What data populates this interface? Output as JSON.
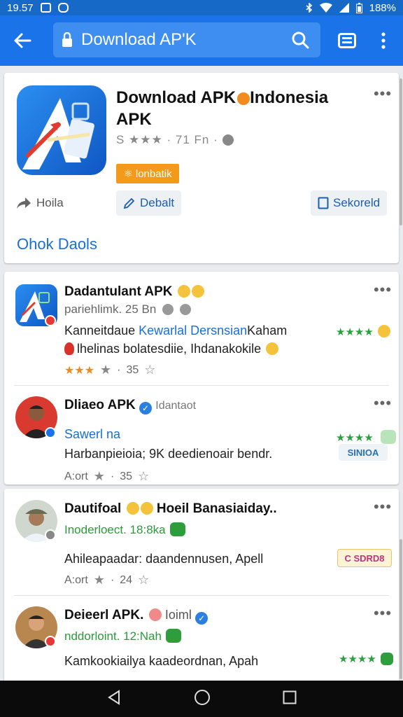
{
  "status_bar": {
    "time": "19.57",
    "battery": "188%"
  },
  "search": {
    "value": "Download AP'K"
  },
  "hero": {
    "title": "Download APK●Indonesia APK",
    "title_line1": "Download APK",
    "title_line1b": "Indonesia",
    "title_line2": "APK",
    "rating_text": "S ★★★ · 71 Fn ·",
    "install_label": "lonbatik",
    "share_label": "Hoila",
    "detail_label": "Debalt",
    "save_label": "Sekoreld",
    "link_label": "Ohok Daols"
  },
  "list_card1": {
    "items": [
      {
        "title": "Dadantulant APK",
        "subtitle": "pariehlimk. 25 Bn",
        "text1_a": "Kanneitdaue ",
        "text1_b": "Kewarlal Dersnsian",
        "text1_c": "Kaham",
        "text2": "lhelinas bolatesdiie, Ihdanakokile",
        "rating": "35",
        "rating_prefix": "★★★"
      },
      {
        "title": "Dliaeo APK",
        "handle": "Idantaot",
        "subtitle_blue": "Sawerl na",
        "text2": "Harbanpieioia; 9K deedienoair bendr.",
        "rating": "35",
        "rating_prefix": "A:ort",
        "pill": "SINIOA"
      }
    ]
  },
  "list_card2": {
    "items": [
      {
        "title": "Dautifoal",
        "title_b": "Hoeil Banasiaiday..",
        "subtitle_green": "Inoderloect. 18:8ka",
        "text": "Ahileapaadar: daandennusen, Apell",
        "rating": "24",
        "rating_prefix": "A:ort",
        "pill": "C SDRD8"
      },
      {
        "title": "Deieerl APK.",
        "handle": "Ioiml",
        "subtitle_green": "nddorloint. 12:Nah",
        "text": "Kamkookiailya kaadeordnan, Apah"
      }
    ]
  },
  "colors": {
    "primary": "#1a73e8",
    "status_bar": "#1769c7",
    "accent_orange": "#f39a1b",
    "green": "#2aa13e",
    "link_blue": "#1a6fd1"
  },
  "icons": [
    "back-arrow-icon",
    "lock-icon",
    "search-icon",
    "tabs-icon",
    "more-vert-icon",
    "share-icon",
    "pencil-icon",
    "bookmark-icon",
    "star-icon",
    "back-nav-icon",
    "home-nav-icon",
    "recents-nav-icon"
  ]
}
